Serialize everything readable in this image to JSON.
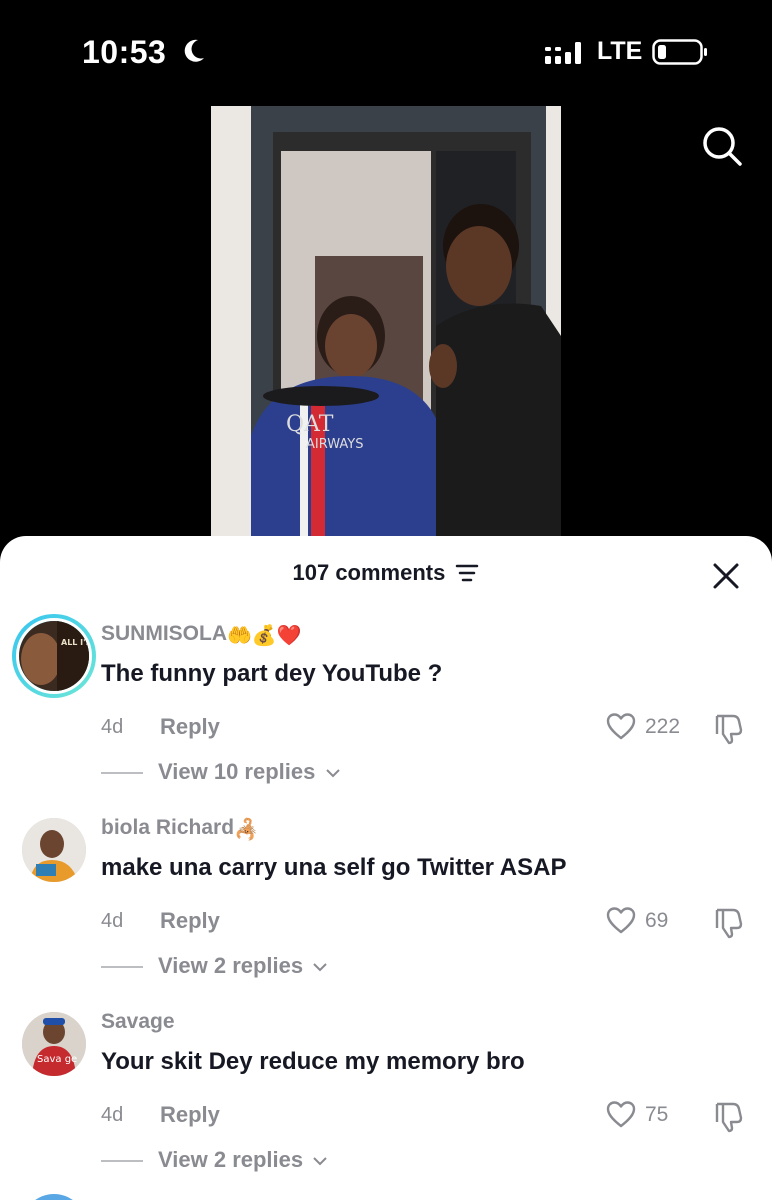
{
  "status": {
    "time": "10:53",
    "network": "LTE"
  },
  "header": {
    "comments_count": "107 comments"
  },
  "comments": [
    {
      "username": "SUNMISOLA",
      "emojis": "🤲💰❤️",
      "text": "The funny part dey YouTube ?",
      "age": "4d",
      "reply_label": "Reply",
      "likes": "222",
      "view_replies": "View 10 replies",
      "avatar_text": "ALL I'M SAYIN'"
    },
    {
      "username": "biola Richard",
      "emojis": "🦂",
      "text": "make una carry una self go Twitter ASAP",
      "age": "4d",
      "reply_label": "Reply",
      "likes": "69",
      "view_replies": "View 2 replies"
    },
    {
      "username": "Savage",
      "emojis": "",
      "text": "Your skit Dey reduce my memory bro",
      "age": "4d",
      "reply_label": "Reply",
      "likes": "75",
      "view_replies": "View 2 replies",
      "avatar_text": "Sava ge"
    }
  ],
  "video": {
    "jersey_text": "QATAR AIRWAYS"
  }
}
